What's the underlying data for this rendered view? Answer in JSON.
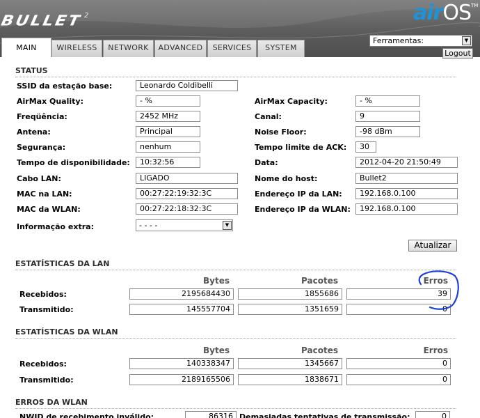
{
  "header": {
    "brand": "BULLET",
    "brand_superscript": "2",
    "logo_air": "air",
    "logo_os": "OS",
    "logo_tm": "TM",
    "tools_selected": "Ferramentas:",
    "logout_label": "Logout",
    "tabs": [
      {
        "label": "MAIN",
        "active": true
      },
      {
        "label": "WIRELESS",
        "active": false
      },
      {
        "label": "NETWORK",
        "active": false
      },
      {
        "label": "ADVANCED",
        "active": false
      },
      {
        "label": "SERVICES",
        "active": false
      },
      {
        "label": "SYSTEM",
        "active": false
      }
    ]
  },
  "status": {
    "title": "STATUS",
    "left": [
      {
        "label": "SSID da estação base:",
        "value": "Leonardo Coldibelli"
      },
      {
        "label": "AirMax Quality:",
        "value": "- %"
      },
      {
        "label": "Freqüência:",
        "value": "2452 MHz"
      },
      {
        "label": "Antena:",
        "value": "Principal"
      },
      {
        "label": "Segurança:",
        "value": "nenhum"
      },
      {
        "label": "Tempo de disponibilidade:",
        "value": "10:32:56"
      },
      {
        "label": "Cabo LAN:",
        "value": "LIGADO"
      },
      {
        "label": "MAC na LAN:",
        "value": "00:27:22:19:32:3C"
      },
      {
        "label": "MAC da WLAN:",
        "value": "00:27:22:18:32:3C"
      }
    ],
    "right": [
      {
        "label": "AirMax Capacity:",
        "value": "- %"
      },
      {
        "label": "Canal:",
        "value": "9"
      },
      {
        "label": "Noise Floor:",
        "value": "-98 dBm"
      },
      {
        "label": "Tempo limite de ACK:",
        "value": "30"
      },
      {
        "label": "Data:",
        "value": "2012-04-20 21:50:49"
      },
      {
        "label": "Nome do host:",
        "value": "Bullet2"
      },
      {
        "label": "Endereço IP da LAN:",
        "value": "192.168.0.100"
      },
      {
        "label": "Endereço IP da WLAN:",
        "value": "192.168.0.100"
      }
    ],
    "extra_label": "Informação extra:",
    "extra_value": "- - - -",
    "refresh_label": "Atualizar"
  },
  "lan_stats": {
    "title": "ESTATÍSTICAS DA LAN",
    "columns": [
      "Bytes",
      "Pacotes",
      "Erros"
    ],
    "rows": [
      {
        "label": "Recebidos:",
        "bytes": "2195684430",
        "packets": "1855686",
        "errors": "39"
      },
      {
        "label": "Transmitido:",
        "bytes": "145557704",
        "packets": "1351659",
        "errors": "0"
      }
    ]
  },
  "wlan_stats": {
    "title": "ESTATÍSTICAS DA WLAN",
    "columns": [
      "Bytes",
      "Pacotes",
      "Erros"
    ],
    "rows": [
      {
        "label": "Recebidos:",
        "bytes": "140338347",
        "packets": "1345667",
        "errors": "0"
      },
      {
        "label": "Transmitido:",
        "bytes": "2189165506",
        "packets": "1838671",
        "errors": "0"
      }
    ]
  },
  "wlan_errors": {
    "title": "ERROS DA WLAN",
    "left_label": "NWID de recebimento inválido:",
    "left_value": "86316",
    "right_label": "Demasiadas tentativas de transmissão:",
    "right_value": "0"
  },
  "colors": {
    "accent_blue": "#1d93d8",
    "annotation": "#1b3fd8"
  }
}
